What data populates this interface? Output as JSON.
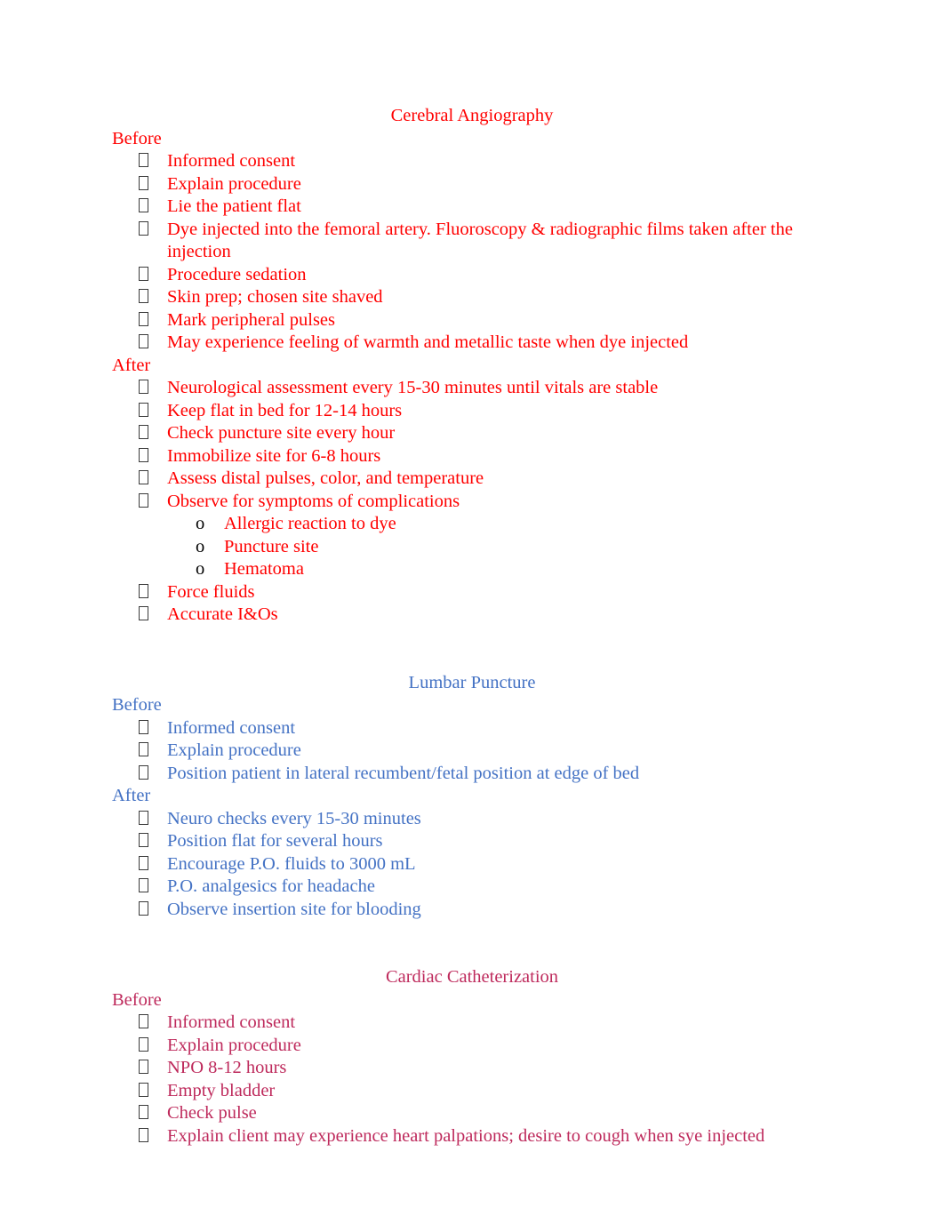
{
  "document": {
    "page_background": "#ffffff",
    "bullet_glyph": "missing-glyph-box",
    "sub_bullet_marker": "o",
    "sub_bullet_marker_color": "#000000"
  },
  "sections": [
    {
      "title": "Cerebral Angiography",
      "color": "#FF0000",
      "groups": [
        {
          "heading": "Before",
          "items": [
            {
              "text": "Informed consent"
            },
            {
              "text": "Explain procedure"
            },
            {
              "text": "Lie the patient flat"
            },
            {
              "text": "Dye injected into the femoral artery. Fluoroscopy & radiographic films taken after the injection"
            },
            {
              "text": "Procedure sedation"
            },
            {
              "text": "Skin prep; chosen site shaved"
            },
            {
              "text": "Mark peripheral pulses"
            },
            {
              "text": "May experience feeling of warmth and metallic taste when dye injected"
            }
          ]
        },
        {
          "heading": "After",
          "items": [
            {
              "text": "Neurological assessment every 15-30 minutes until vitals are stable"
            },
            {
              "text": "Keep flat in bed for 12-14 hours"
            },
            {
              "text": "Check puncture site every hour"
            },
            {
              "text": "Immobilize site for 6-8 hours"
            },
            {
              "text": "Assess distal pulses, color, and temperature"
            },
            {
              "text": "Observe for symptoms of complications",
              "subitems": [
                {
                  "text": "Allergic reaction to dye"
                },
                {
                  "text": "Puncture site"
                },
                {
                  "text": "Hematoma"
                }
              ]
            },
            {
              "text": "Force fluids"
            },
            {
              "text": "Accurate I&Os"
            }
          ]
        }
      ]
    },
    {
      "title": "Lumbar Puncture",
      "color": "#4472C4",
      "groups": [
        {
          "heading": "Before",
          "items": [
            {
              "text": "Informed consent"
            },
            {
              "text": "Explain procedure"
            },
            {
              "text": "Position patient in lateral recumbent/fetal position at edge of bed"
            }
          ]
        },
        {
          "heading": "After",
          "items": [
            {
              "text": "Neuro checks every 15-30 minutes"
            },
            {
              "text": "Position flat for several hours"
            },
            {
              "text": "Encourage P.O. fluids to 3000 mL"
            },
            {
              "text": "P.O. analgesics for headache"
            },
            {
              "text": "Observe insertion site for blooding"
            }
          ]
        }
      ]
    },
    {
      "title": "Cardiac Catheterization",
      "color": "#BE2A5C",
      "groups": [
        {
          "heading": "Before",
          "items": [
            {
              "text": "Informed consent"
            },
            {
              "text": "Explain procedure"
            },
            {
              "text": "NPO 8-12 hours"
            },
            {
              "text": "Empty bladder"
            },
            {
              "text": "Check pulse"
            },
            {
              "text": "Explain client may experience heart palpations; desire to cough when sye injected"
            }
          ]
        }
      ]
    }
  ]
}
